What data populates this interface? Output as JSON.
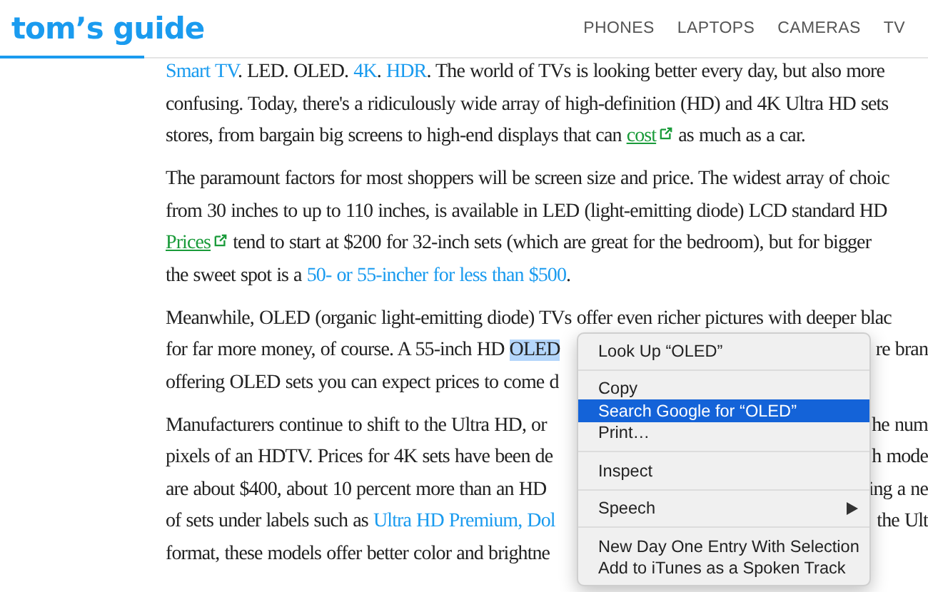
{
  "header": {
    "logo": "tom’s guide",
    "nav": [
      "PHONES",
      "LAPTOPS",
      "CAMERAS",
      "TV"
    ]
  },
  "paragraphs": [
    {
      "lines": [
        {
          "segments": [
            {
              "kind": "link",
              "text": "Smart TV"
            },
            {
              "kind": "text",
              "text": ". LED. OLED. "
            },
            {
              "kind": "link",
              "text": "4K"
            },
            {
              "kind": "text",
              "text": ". "
            },
            {
              "kind": "link",
              "text": "HDR"
            },
            {
              "kind": "text",
              "text": ". The world of TVs is looking better every day, but also more"
            }
          ]
        },
        {
          "segments": [
            {
              "kind": "text",
              "text": "confusing. Today, there's a ridiculously wide array of high-definition (HD) and 4K Ultra HD sets"
            }
          ]
        },
        {
          "segments": [
            {
              "kind": "text",
              "text": "stores, from bargain big screens to high-end displays that can "
            },
            {
              "kind": "affiliate",
              "text": "cost"
            },
            {
              "kind": "text",
              "text": " as much as a car."
            }
          ]
        }
      ]
    },
    {
      "lines": [
        {
          "segments": [
            {
              "kind": "text",
              "text": "The paramount factors for most shoppers will be screen size and price. The widest array of choic"
            }
          ]
        },
        {
          "segments": [
            {
              "kind": "text",
              "text": "from 30 inches to up to 110 inches, is available in LED (light-emitting diode) LCD standard HD"
            }
          ]
        },
        {
          "segments": [
            {
              "kind": "affiliate",
              "text": "Prices"
            },
            {
              "kind": "text",
              "text": " tend to start at $200 for 32-inch sets (which are great for the bedroom), but for bigger"
            }
          ]
        },
        {
          "segments": [
            {
              "kind": "text",
              "text": "the sweet spot is a "
            },
            {
              "kind": "link",
              "text": "50- or 55-incher for less than $500"
            },
            {
              "kind": "text",
              "text": "."
            }
          ]
        }
      ]
    },
    {
      "lines": [
        {
          "segments": [
            {
              "kind": "text",
              "text": "Meanwhile, OLED (organic light-emitting diode) TVs offer even richer pictures with deeper blac"
            }
          ]
        },
        {
          "segments": [
            {
              "kind": "text",
              "text": "for far more money, of course. A 55-inch HD "
            },
            {
              "kind": "selected",
              "text": "OLED"
            }
          ],
          "right": "re bran"
        },
        {
          "segments": [
            {
              "kind": "text",
              "text": "offering OLED sets you can expect prices to come d"
            }
          ]
        }
      ]
    },
    {
      "lines": [
        {
          "segments": [
            {
              "kind": "text",
              "text": "Manufacturers continue to shift to the Ultra HD, or"
            }
          ],
          "right": "he num"
        },
        {
          "segments": [
            {
              "kind": "text",
              "text": "pixels of an HDTV.  Prices for 4K sets have been de"
            }
          ],
          "right": "h mode"
        },
        {
          "segments": [
            {
              "kind": "text",
              "text": "are about $400, about 10 percent more than an HD"
            }
          ],
          "right": "ing a ne"
        },
        {
          "segments": [
            {
              "kind": "text",
              "text": "of sets under labels such as "
            },
            {
              "kind": "link",
              "text": "Ultra HD Premium, Dol"
            }
          ],
          "right": "the Ult"
        },
        {
          "segments": [
            {
              "kind": "text",
              "text": "format, these models offer better color and brightne"
            }
          ]
        }
      ]
    }
  ],
  "context_menu": {
    "groups": [
      [
        {
          "label": "Look Up “OLED”",
          "selected": false,
          "submenu": false
        }
      ],
      [
        {
          "label": "Copy",
          "selected": false,
          "submenu": false
        },
        {
          "label": "Search Google for “OLED”",
          "selected": true,
          "submenu": false
        },
        {
          "label": "Print…",
          "selected": false,
          "submenu": false
        }
      ],
      [
        {
          "label": "Inspect",
          "selected": false,
          "submenu": false
        }
      ],
      [
        {
          "label": "Speech",
          "selected": false,
          "submenu": true
        }
      ],
      [
        {
          "label": "New Day One Entry With Selection",
          "selected": false,
          "submenu": false
        },
        {
          "label": "Add to iTunes as a Spoken Track",
          "selected": false,
          "submenu": false
        }
      ]
    ]
  }
}
